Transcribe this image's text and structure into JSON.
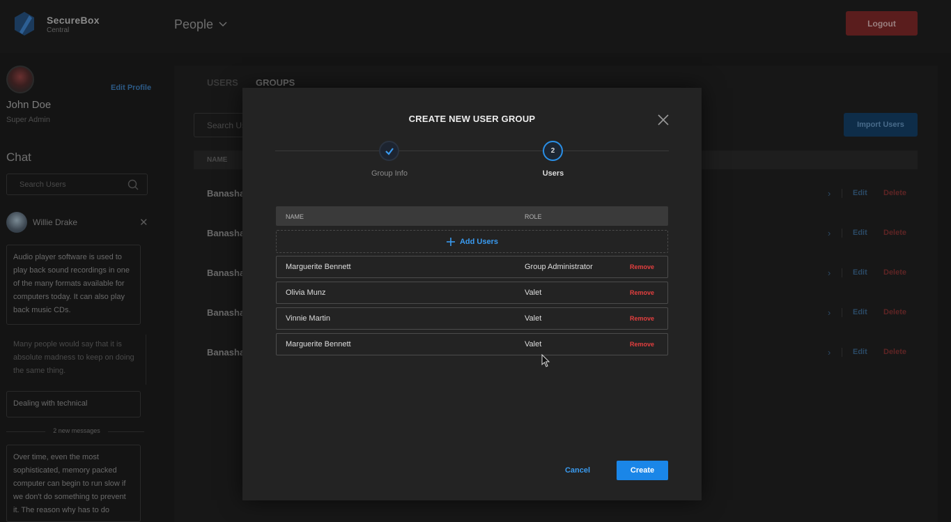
{
  "app": {
    "brand_name": "SecureBox",
    "brand_sub": "Central",
    "section_title": "People",
    "logout_label": "Logout",
    "colors": {
      "accent": "#1a86e8",
      "danger": "#e53f3f",
      "background": "#141414",
      "modal": "#232323"
    }
  },
  "profile": {
    "edit_label": "Edit Profile",
    "name": "John Doe",
    "role": "Super Admin"
  },
  "chat": {
    "title": "Chat",
    "search_placeholder": "Search Users",
    "contact_name": "Willie Drake",
    "messages": [
      "Audio player software is used to play back sound recordings in one of the many formats available for computers today. It can also play back music CDs.",
      "Many people would say that it is absolute madness to keep on doing the same thing.",
      "Dealing with technical",
      "Over time, even the most sophisticated, memory packed computer can begin to run slow if we don't do something to prevent it. The reason why has to do"
    ],
    "new_messages_label": "2 new messages"
  },
  "main": {
    "tabs": [
      {
        "label": "USERS"
      },
      {
        "label": "GROUPS"
      }
    ],
    "search_placeholder": "Search Users",
    "import_label": "Import Users",
    "table_header_name": "NAME",
    "rows": [
      {
        "name": "Banasha",
        "edit": "Edit",
        "delete": "Delete"
      },
      {
        "name": "Banasha",
        "edit": "Edit",
        "delete": "Delete"
      },
      {
        "name": "Banasha",
        "edit": "Edit",
        "delete": "Delete"
      },
      {
        "name": "Banasha",
        "edit": "Edit",
        "delete": "Delete"
      },
      {
        "name": "Banasha",
        "edit": "Edit",
        "delete": "Delete"
      }
    ]
  },
  "modal": {
    "title": "CREATE NEW USER GROUP",
    "steps": [
      {
        "label": "Group Info",
        "state": "done"
      },
      {
        "label": "Users",
        "number": "2",
        "state": "active"
      }
    ],
    "table": {
      "col_name": "NAME",
      "col_role": "ROLE",
      "add_users_label": "Add Users",
      "rows": [
        {
          "name": "Marguerite Bennett",
          "role": "Group Administrator",
          "action": "Remove"
        },
        {
          "name": "Olivia Munz",
          "role": "Valet",
          "action": "Remove"
        },
        {
          "name": "Vinnie Martin",
          "role": "Valet",
          "action": "Remove"
        },
        {
          "name": "Marguerite Bennett",
          "role": "Valet",
          "action": "Remove"
        }
      ]
    },
    "cancel_label": "Cancel",
    "create_label": "Create"
  }
}
